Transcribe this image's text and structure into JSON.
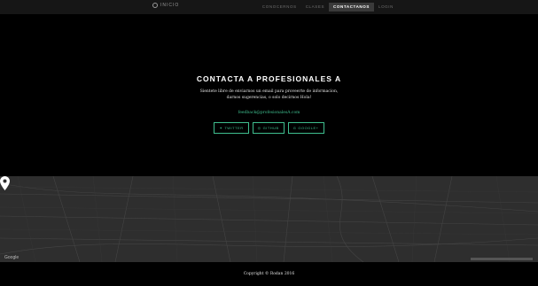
{
  "navbar": {
    "brand": "INICIO",
    "links": [
      {
        "label": "CONOCERNOS"
      },
      {
        "label": "CLASES"
      },
      {
        "label": "CONTACTANOS"
      },
      {
        "label": "LOGIN"
      }
    ]
  },
  "hero": {
    "title": "CONTACTA A PROFESIONALES A",
    "lead": "Sientete libre de enviarnos un email para proveerte de informacion, darnos sugerencias, o solo decirnos Hola!",
    "email": "feedback@profesionalesA.com",
    "buttons": [
      {
        "label": "TWITTER",
        "icon": "twitter-icon",
        "glyph": "✦"
      },
      {
        "label": "GITHUB",
        "icon": "github-icon",
        "glyph": "◎"
      },
      {
        "label": "GOOGLE+",
        "icon": "google-plus-icon",
        "glyph": "g"
      }
    ]
  },
  "map": {
    "provider": "Google"
  },
  "footer": {
    "copyright": "Copyright © Rodan 2016"
  },
  "colors": {
    "accent": "#3fbf8f",
    "background": "#000000",
    "navbar": "#161616",
    "map": "#2b2b2b"
  }
}
